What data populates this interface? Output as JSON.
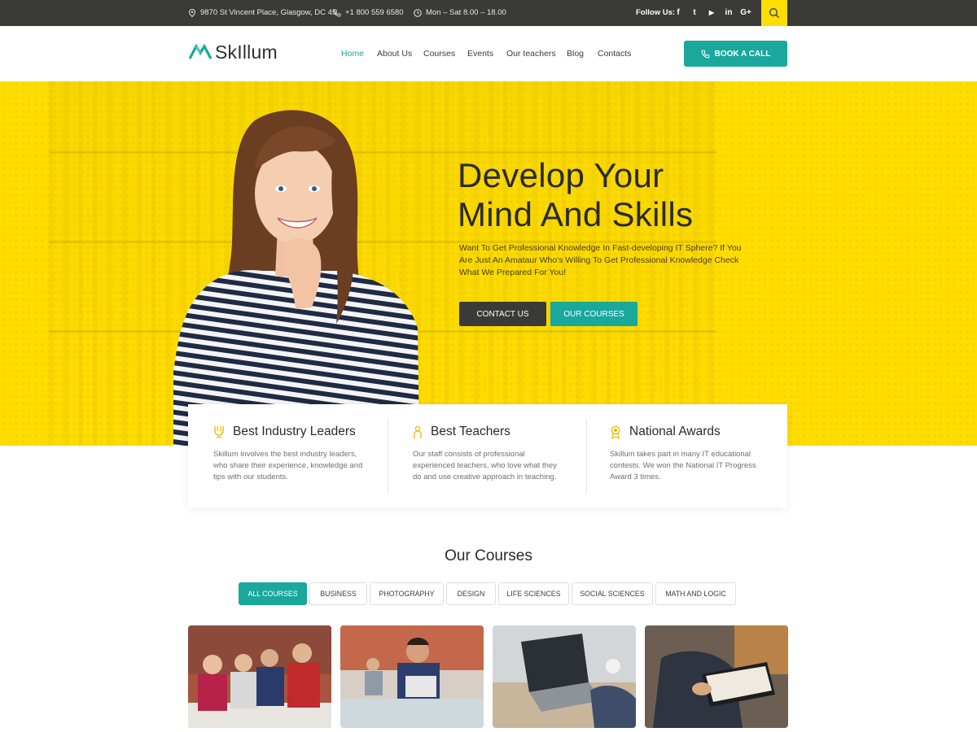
{
  "topbar": {
    "address": "9870 St Vincent Place, Glasgow, DC 45",
    "phone": "+1 800 559 6580",
    "hours": "Mon – Sat 8.00 – 18.00",
    "follow_label": "Follow Us:",
    "social": [
      {
        "icon": "facebook-icon",
        "glyph": "f"
      },
      {
        "icon": "twitter-icon",
        "glyph": "t"
      },
      {
        "icon": "youtube-icon",
        "glyph": "▶"
      },
      {
        "icon": "linkedin-icon",
        "glyph": "in"
      },
      {
        "icon": "google-plus-icon",
        "glyph": "G+"
      }
    ]
  },
  "header": {
    "logo": "SkIllum",
    "nav": [
      "Home",
      "About Us",
      "Courses",
      "Events",
      "Our teachers",
      "Blog",
      "Contacts"
    ],
    "active_nav": "Home",
    "cta": "BOOK A CALL"
  },
  "hero": {
    "title_line1": "Develop Your",
    "title_line2": "Mind And Skills",
    "text": "Want To Get Professional Knowledge In Fast-developing IT Sphere? If You Are Just An Amataur Who's Willing To Get Professional Knowledge Check What We Prepared For You!",
    "btn_contact": "CONTACT US",
    "btn_courses": "OUR COURSES"
  },
  "features": [
    {
      "icon": "award-ribbon-icon",
      "title": "Best Industry Leaders",
      "text": "Skillum involves the best industry leaders, who share their experience, knowledge and tips with our students."
    },
    {
      "icon": "teacher-icon",
      "title": "Best Teachers",
      "text": "Our staff consists of professional experienced teachers, who love what they do and use creative approach in teaching."
    },
    {
      "icon": "medal-icon",
      "title": "National Awards",
      "text": "Skillum takes part in many IT educational contests. We won the National IT Progress Award 3 times."
    }
  ],
  "courses": {
    "title": "Our Courses",
    "filters": [
      "ALL COURSES",
      "BUSINESS",
      "PHOTOGRAPHY",
      "DESIGN",
      "LIFE SCIENCES",
      "SOCIAL SCIENCES",
      "MATH AND LOGIC"
    ],
    "active_filter": "ALL COURSES"
  },
  "colors": {
    "accent": "#1aa79c",
    "hero_yellow": "#ffdd00",
    "dark": "#3a3a36"
  }
}
